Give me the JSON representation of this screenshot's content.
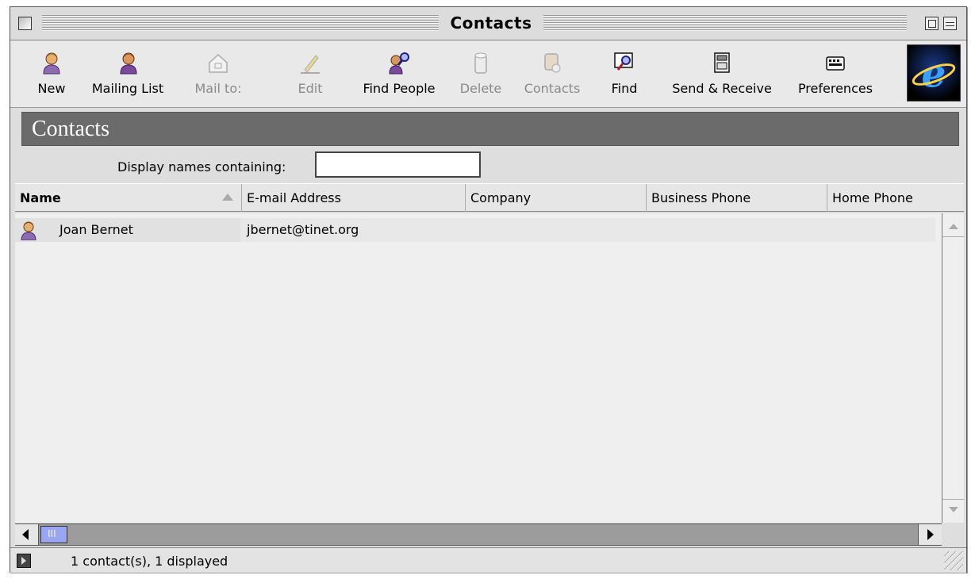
{
  "window": {
    "title": "Contacts"
  },
  "toolbar": {
    "buttons": [
      {
        "label": "New",
        "icon": "person-icon",
        "enabled": true
      },
      {
        "label": "Mailing List",
        "icon": "group-icon",
        "enabled": true
      },
      {
        "label": "Mail to:",
        "icon": "house-mail-icon",
        "enabled": false
      },
      {
        "label": "Edit",
        "icon": "pencil-icon",
        "enabled": false
      },
      {
        "label": "Find People",
        "icon": "find-people-icon",
        "enabled": true
      },
      {
        "label": "Delete",
        "icon": "trash-icon",
        "enabled": false
      },
      {
        "label": "Contacts",
        "icon": "contacts-card-icon",
        "enabled": false
      },
      {
        "label": "Find",
        "icon": "find-icon",
        "enabled": true
      },
      {
        "label": "Send & Receive",
        "icon": "send-receive-icon",
        "enabled": true
      },
      {
        "label": "Preferences",
        "icon": "preferences-icon",
        "enabled": true
      }
    ],
    "logo": "internet-explorer-logo"
  },
  "header": {
    "title": "Contacts"
  },
  "filter": {
    "label": "Display names containing:",
    "value": ""
  },
  "columns": [
    "Name",
    "E-mail Address",
    "Company",
    "Business Phone",
    "Home Phone"
  ],
  "sorted_column": "Name",
  "contacts": [
    {
      "name": "Joan Bernet",
      "email": "jbernet@tinet.org",
      "company": "",
      "business_phone": "",
      "home_phone": ""
    }
  ],
  "status": {
    "text": "1 contact(s), 1 displayed"
  },
  "colors": {
    "header_band": "#6b6b6b",
    "scroll_thumb": "#9aa6f0",
    "window_bg": "#dedede"
  }
}
